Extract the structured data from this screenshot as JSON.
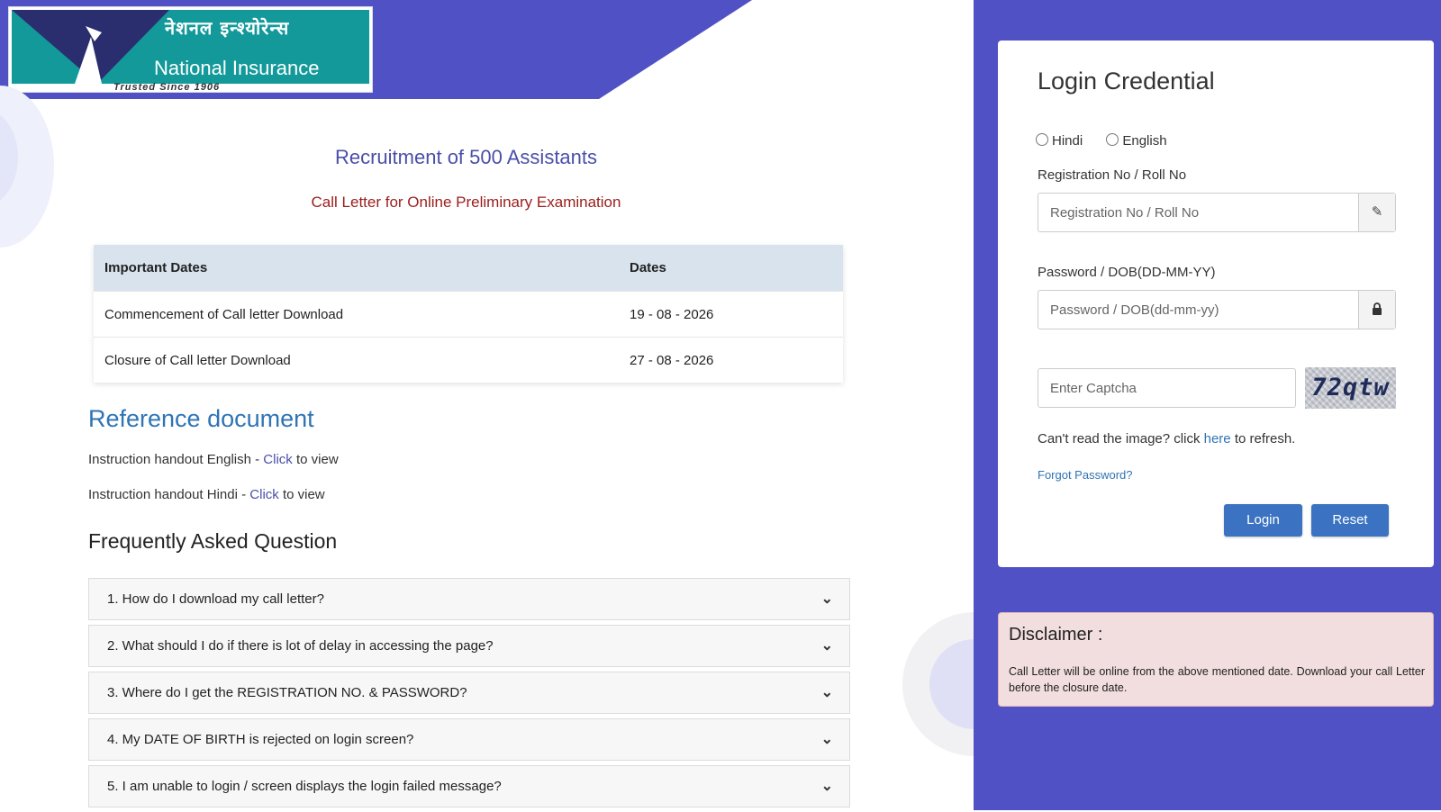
{
  "logo": {
    "hindi": "नेशनल इन्श्योरेन्स",
    "english": "National Insurance",
    "tagline": "Trusted Since 1906"
  },
  "header": {
    "title": "Recruitment of 500 Assistants",
    "subtitle": "Call Letter for Online Preliminary Examination"
  },
  "dates_table": {
    "headers": [
      "Important Dates",
      "Dates"
    ],
    "rows": [
      [
        "Commencement of Call letter Download",
        "19 - 08 - 2026"
      ],
      [
        "Closure of Call letter Download",
        "27 - 08 - 2026"
      ]
    ]
  },
  "reference": {
    "title": "Reference document",
    "items": [
      {
        "prefix": "Instruction handout English - ",
        "link": "Click",
        "suffix": " to view"
      },
      {
        "prefix": "Instruction handout Hindi - ",
        "link": "Click",
        "suffix": " to view"
      }
    ]
  },
  "faq": {
    "title": "Frequently Asked Question",
    "items": [
      "1. How do I download my call letter?",
      "2. What should I do if there is lot of delay in accessing the page?",
      "3. Where do I get the REGISTRATION NO. & PASSWORD?",
      "4. My DATE OF BIRTH is rejected on login screen?",
      "5. I am unable to login / screen displays the login failed message?"
    ]
  },
  "login": {
    "title": "Login Credential",
    "languages": [
      "Hindi",
      "English"
    ],
    "reg_label": "Registration No / Roll No",
    "reg_placeholder": "Registration No / Roll No",
    "pwd_label": "Password / DOB(DD-MM-YY)",
    "pwd_placeholder": "Password / DOB(dd-mm-yy)",
    "captcha_placeholder": "Enter Captcha",
    "captcha_text": "72qtw",
    "refresh_prefix": "Can't read the image? click ",
    "refresh_link": "here",
    "refresh_suffix": " to refresh.",
    "forgot": "Forgot Password?",
    "login_button": "Login",
    "reset_button": "Reset"
  },
  "disclaimer": {
    "title": "Disclaimer :",
    "text": "Call Letter will be online from the above mentioned date. Download your call Letter before the closure date."
  },
  "colors": {
    "brand_purple": "#4f51c4",
    "logo_teal": "#13999a",
    "title_blue": "#4b4fa8",
    "subtitle_red": "#9b1d1d",
    "link_blue": "#2f74b5",
    "button_blue": "#3b73c2",
    "disclaimer_bg": "#f2dede"
  }
}
